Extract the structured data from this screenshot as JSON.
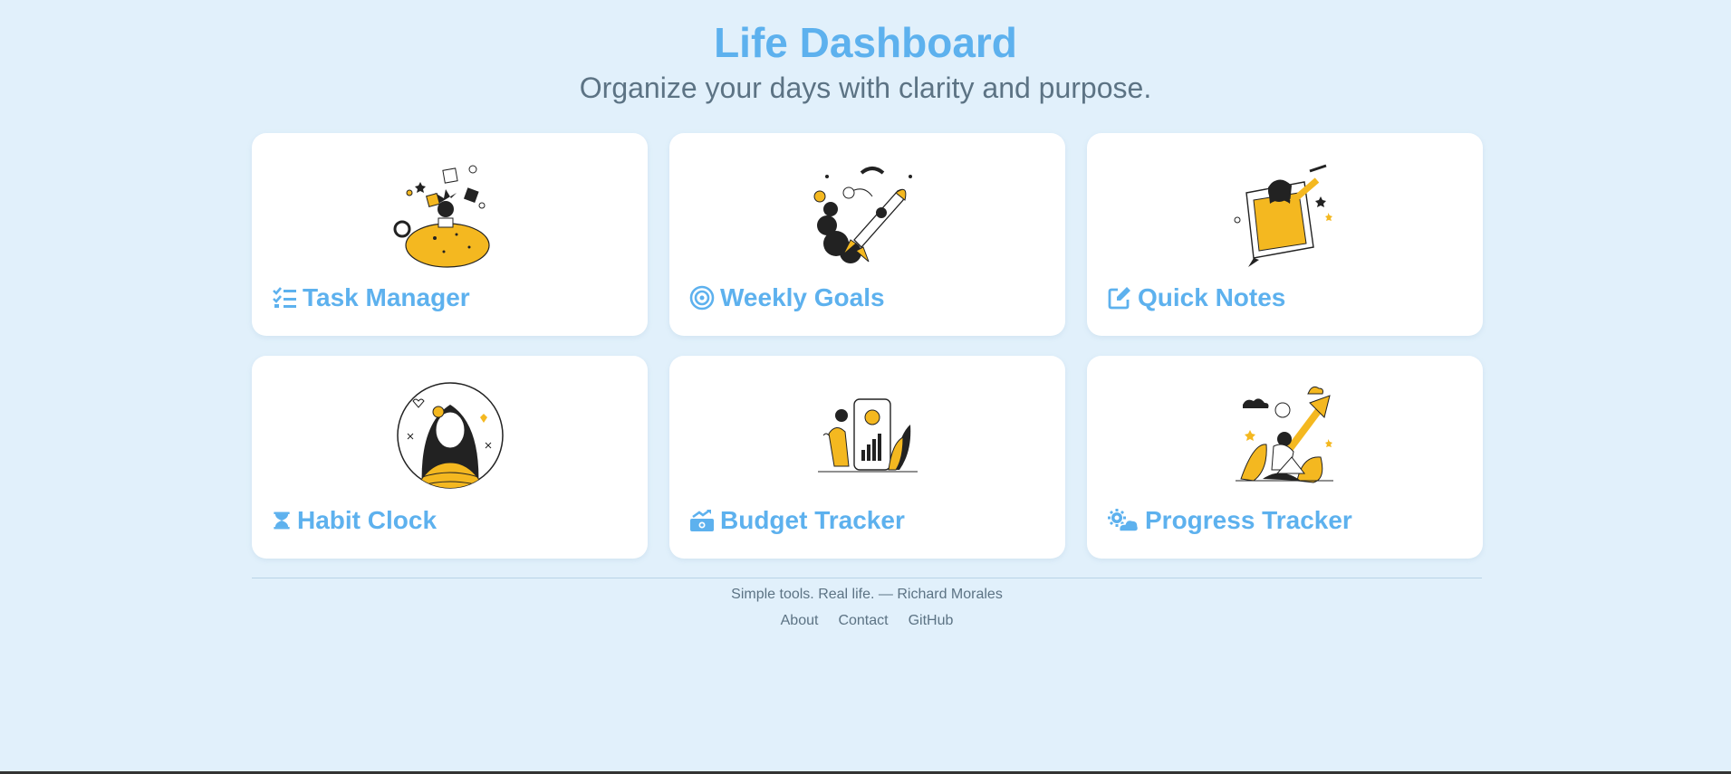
{
  "header": {
    "title": "Life Dashboard",
    "subtitle": "Organize your days with clarity and purpose."
  },
  "colors": {
    "background": "#e1f0fb",
    "accent": "#5db1ee",
    "illustration_yellow": "#f4b820",
    "muted_text": "#5c7384"
  },
  "cards": [
    {
      "label": "Task Manager",
      "icon": "list-check-icon",
      "illustration": "person-with-floating-icons-illustration"
    },
    {
      "label": "Weekly Goals",
      "icon": "bullseye-icon",
      "illustration": "rocket-launch-illustration"
    },
    {
      "label": "Quick Notes",
      "icon": "pen-to-square-icon",
      "illustration": "woman-in-frame-illustration"
    },
    {
      "label": "Habit Clock",
      "icon": "hourglass-icon",
      "illustration": "woman-portrait-circle-illustration"
    },
    {
      "label": "Budget Tracker",
      "icon": "money-bill-trend-up-icon",
      "illustration": "phone-with-bar-chart-illustration"
    },
    {
      "label": "Progress Tracker",
      "icon": "cloud-sun-gear-icon",
      "illustration": "person-with-laptop-arrow-illustration"
    }
  ],
  "footer": {
    "credit": "Simple tools. Real life. — Richard Morales",
    "links": [
      "About",
      "Contact",
      "GitHub"
    ]
  }
}
